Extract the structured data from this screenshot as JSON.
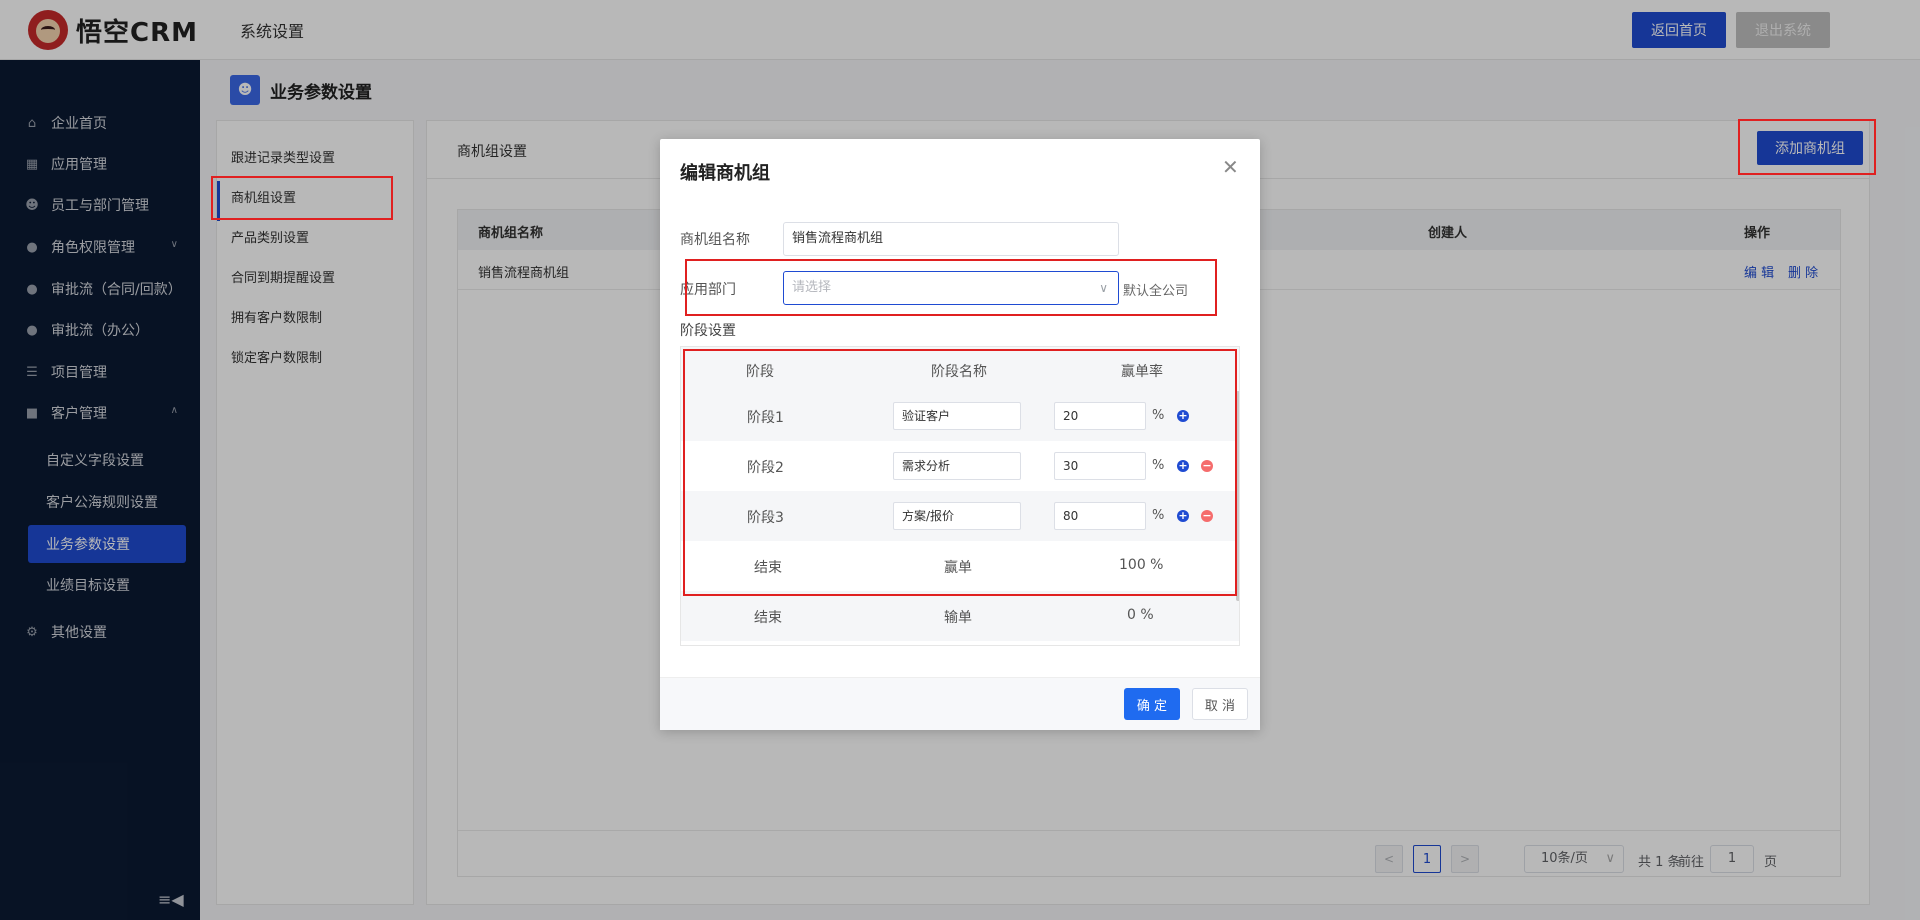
{
  "app": {
    "logo_text": "悟空CRM",
    "section_title": "系统设置",
    "home_button": "返回首页",
    "exit_button": "退出系统"
  },
  "sidebar": {
    "items": [
      {
        "label": "企业首页",
        "icon": "home-icon"
      },
      {
        "label": "应用管理",
        "icon": "grid-icon"
      },
      {
        "label": "员工与部门管理",
        "icon": "users-icon"
      },
      {
        "label": "角色权限管理",
        "icon": "user-icon"
      },
      {
        "label": "审批流（合同/回款）",
        "icon": "user-icon"
      },
      {
        "label": "审批流（办公）",
        "icon": "user-icon"
      },
      {
        "label": "项目管理",
        "icon": "list-icon"
      },
      {
        "label": "客户管理",
        "icon": "building-icon"
      },
      {
        "label": "其他设置",
        "icon": "gear-icon"
      }
    ],
    "sub_items": [
      "自定义字段设置",
      "客户公海规则设置",
      "业务参数设置",
      "业绩目标设置"
    ],
    "active_sub": "业务参数设置"
  },
  "page": {
    "title": "业务参数设置"
  },
  "settings_menu": [
    "跟进记录类型设置",
    "商机组设置",
    "产品类别设置",
    "合同到期提醒设置",
    "拥有客户数限制",
    "锁定客户数限制"
  ],
  "panel": {
    "title": "商机组设置",
    "add_button": "添加商机组",
    "columns": {
      "name": "商机组名称",
      "creator": "创建人",
      "actions": "操作"
    },
    "rows": [
      {
        "name": "销售流程商机组",
        "edit": "编 辑",
        "delete": "删 除"
      }
    ]
  },
  "pagination": {
    "current": "1",
    "page_size": "10条/页",
    "total": "共 1 条",
    "goto": "前往",
    "goto_value": "1",
    "page_unit": "页"
  },
  "dialog": {
    "title": "编辑商机组",
    "name_label": "商机组名称",
    "name_value": "销售流程商机组",
    "dept_label": "应用部门",
    "dept_placeholder": "请选择",
    "dept_hint": "默认全公司",
    "stage_section": "阶段设置",
    "stage_headers": {
      "stage": "阶段",
      "name": "阶段名称",
      "rate": "赢单率"
    },
    "stages": [
      {
        "stage": "阶段1",
        "name": "验证客户",
        "rate": "20",
        "pct": "%"
      },
      {
        "stage": "阶段2",
        "name": "需求分析",
        "rate": "30",
        "pct": "%"
      },
      {
        "stage": "阶段3",
        "name": "方案/报价",
        "rate": "80",
        "pct": "%"
      }
    ],
    "end_rows": [
      {
        "stage": "结束",
        "name": "赢单",
        "rate": "100 %"
      },
      {
        "stage": "结束",
        "name": "输单",
        "rate": "0 %"
      }
    ],
    "ok_button": "确 定",
    "cancel_button": "取 消"
  },
  "colors": {
    "primary": "#1f4bd2",
    "sidebar_bg": "#0b1a33",
    "danger": "#f56c6c",
    "annotation": "#e02020"
  }
}
